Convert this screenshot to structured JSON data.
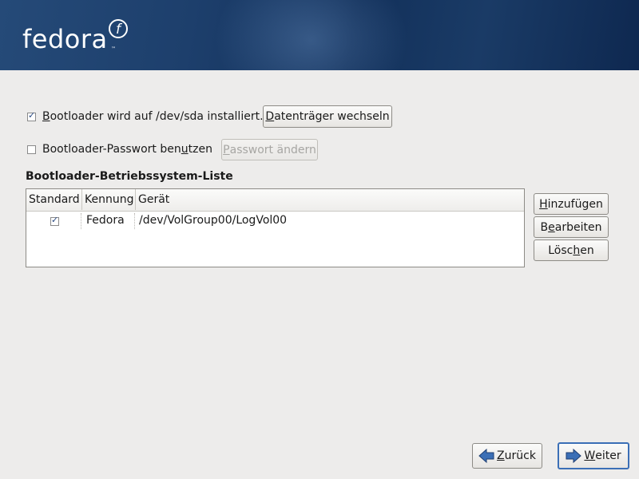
{
  "header": {
    "logo_text": "fedora",
    "logo_mark": "f",
    "trademark": "™"
  },
  "bootloader": {
    "install_checked": true,
    "install_label_first": "B",
    "install_label_rest": "ootloader wird auf /dev/sda installiert.",
    "change_device_first": "D",
    "change_device_rest": "atenträger wechseln",
    "password_checked": false,
    "password_label_pre": "Bootloader-Passwort ben",
    "password_label_u": "u",
    "password_label_post": "tzen",
    "change_password_first": "P",
    "change_password_rest": "asswort ändern"
  },
  "os_list": {
    "title": "Bootloader-Betriebssystem-Liste",
    "columns": [
      "Standard",
      "Kennung",
      "Gerät"
    ],
    "rows": [
      {
        "default": true,
        "label": "Fedora",
        "device": "/dev/VolGroup00/LogVol00"
      }
    ],
    "buttons": {
      "add_first": "H",
      "add_rest": "inzufügen",
      "edit_pre": "B",
      "edit_u": "e",
      "edit_post": "arbeiten",
      "delete_pre": "Lösc",
      "delete_u": "h",
      "delete_post": "en"
    }
  },
  "nav": {
    "back_first": "Z",
    "back_rest": "urück",
    "next_first": "W",
    "next_rest": "eiter"
  }
}
